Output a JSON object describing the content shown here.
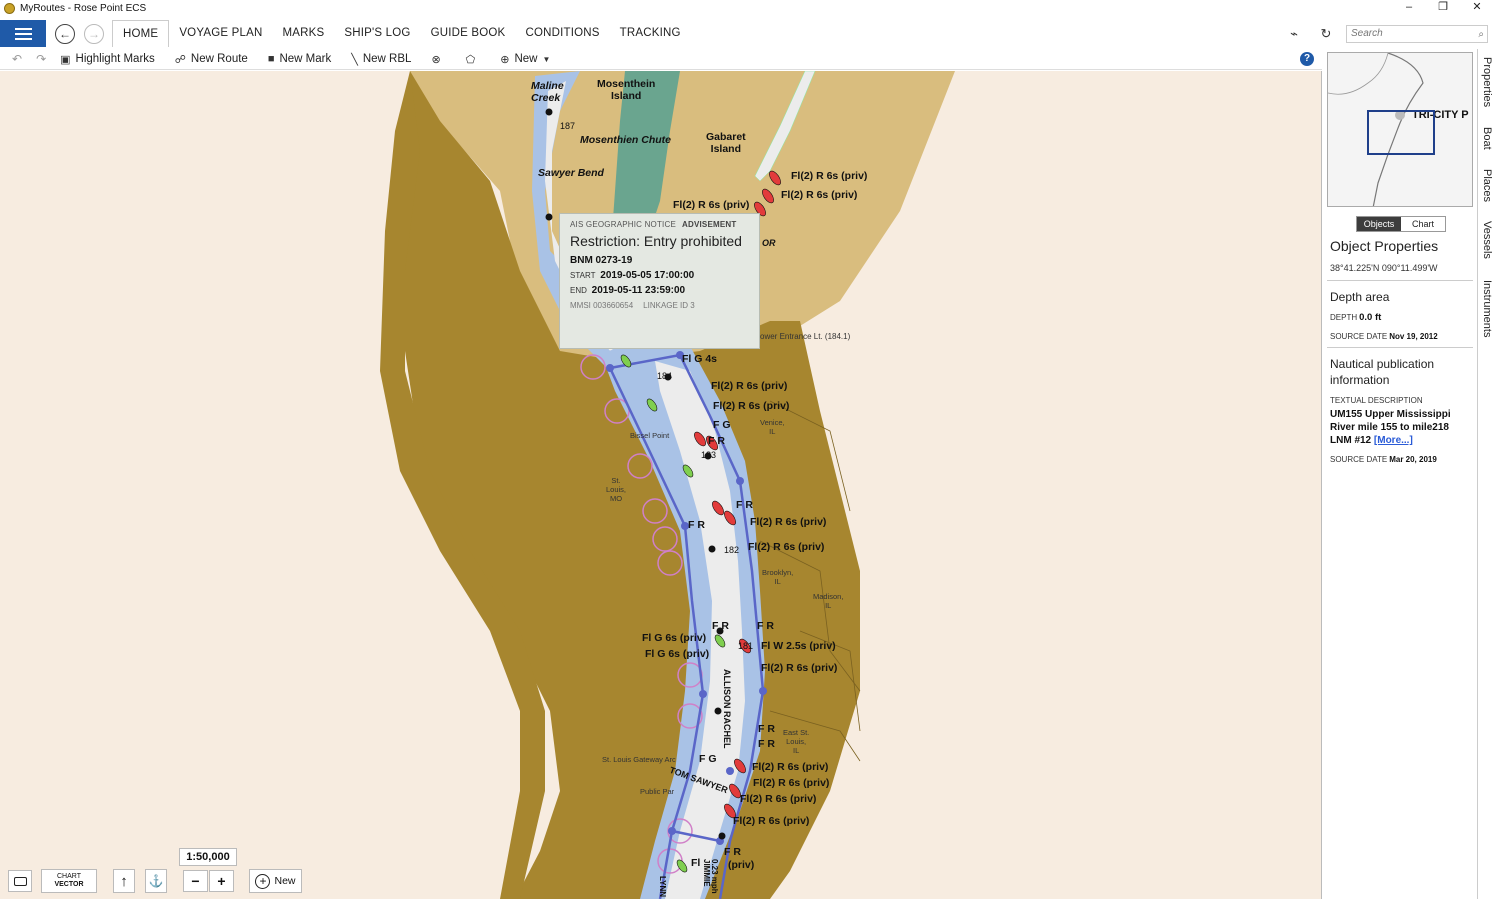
{
  "window": {
    "title": "MyRoutes - Rose Point ECS",
    "controls": [
      "–",
      "❐",
      "✕"
    ]
  },
  "menu": {
    "tabs": [
      "HOME",
      "VOYAGE PLAN",
      "MARKS",
      "SHIP'S LOG",
      "GUIDE BOOK",
      "CONDITIONS",
      "TRACKING"
    ],
    "active_tab": "HOME",
    "search_placeholder": "Search"
  },
  "toolbar": {
    "highlight_marks": "Highlight Marks",
    "new_route": "New Route",
    "new_mark": "New Mark",
    "new_rbl": "New RBL",
    "new": "New"
  },
  "chart": {
    "labels": {
      "maline_creek": "Maline\nCreek",
      "mosenthein_island": "Mosenthein\nIsland",
      "mosenthien_chute": "Mosenthien Chute",
      "gabaret_island": "Gabaret\nIsland",
      "sawyer_bend": "Sawyer Bend",
      "mile_187": "187",
      "mile_184": "184",
      "mile_183": "183",
      "mile_182": "182",
      "mile_181": "181",
      "light_1": "Fl(2) R 6s (priv)",
      "light_2": "Fl(2) R 6s (priv)",
      "light_3": "Fl(2) R 6s (priv)",
      "lower_entrance": "ower Entrance Lt. (184.1)",
      "fl_g_4s": "Fl G 4s",
      "light_4": "Fl(2) R 6s (priv)",
      "light_5": "Fl(2) R 6s (priv)",
      "fg_1": "F G",
      "fr_1": "F R",
      "venice": "Venice,\nIL",
      "bissel_point": "Bissel Point",
      "st_louis": "St.\nLouis,\nMO",
      "fr_2": "F R",
      "fr_3": "F R",
      "light_6": "Fl(2) R 6s (priv)",
      "light_7": "Fl(2) R 6s (priv)",
      "brooklyn": "Brooklyn,\nIL",
      "madison": "Madison,\nIL",
      "fr_4": "F R",
      "fr_5": "F R",
      "fl_g_6s_1": "Fl G 6s (priv)",
      "fl_g_6s_2": "Fl G 6s (priv)",
      "fl_w": "Fl W 2.5s (priv)",
      "light_8": "Fl(2) R 6s (priv)",
      "allison": "ALLISON RACHEL",
      "east_st_louis": "East St.\nLouis,\nIL",
      "fr_6": "F R",
      "fr_7": "F R",
      "fg_2": "F G",
      "gateway_arch": "St. Louis Gateway Arc",
      "public_park": "Public Par",
      "tom_sawyer": "TOM SAWYER",
      "light_9": "Fl(2) R 6s (priv)",
      "light_10": "Fl(2) R 6s (priv)",
      "light_11": "Fl(2) R 6s (priv)",
      "light_12": "Fl(2) R 6s (priv)",
      "fr_8": "F R",
      "fl_priv": "Fl",
      "priv": "(priv)",
      "jimmie": "JIMMIE",
      "mph": "0.23 mph",
      "lynn": "LYNN",
      "or_partial": "OR"
    },
    "scale": "1:50,000",
    "chart_mode_line1": "CHART",
    "chart_mode_line2": "VECTOR",
    "zoom_out": "−",
    "zoom_in": "+",
    "new_button": "New",
    "colors": {
      "land_dark": "#a7862f",
      "land_light": "#d9bd7e",
      "water_shallow": "#a9c2e6",
      "water_deep": "#ececec",
      "route": "#5a66c8",
      "island_green": "#6aa58f"
    }
  },
  "popup": {
    "category": "AIS GEOGRAPHIC NOTICE",
    "type": "ADVISEMENT",
    "title": "Restriction: Entry prohibited",
    "bnm": "BNM 0273-19",
    "start_label": "START",
    "start_value": "2019-05-05 17:00:00",
    "end_label": "END",
    "end_value": "2019-05-11 23:59:00",
    "mmsi": "MMSI 003660654",
    "linkage": "LINKAGE ID 3"
  },
  "right_panel": {
    "minimap_label": "TRI-CITY P",
    "segment_objects": "Objects",
    "segment_chart": "Chart",
    "title": "Object Properties",
    "coords": "38°41.225'N 090°11.499'W",
    "depth_area": {
      "heading": "Depth area",
      "depth_label": "DEPTH",
      "depth_value": "0.0 ft",
      "source_label": "SOURCE DATE",
      "source_value": "Nov 19, 2012"
    },
    "nautical": {
      "heading": "Nautical publication information",
      "textual_label": "TEXTUAL DESCRIPTION",
      "textual_value": "UM155 Upper Mississippi River mile 155 to mile218 LNM #12",
      "more_link": "[More...]",
      "source_label": "SOURCE DATE",
      "source_value": "Mar 20, 2019"
    }
  },
  "side_tabs": [
    "Properties",
    "Boat",
    "Places",
    "Vessels",
    "Instruments"
  ]
}
